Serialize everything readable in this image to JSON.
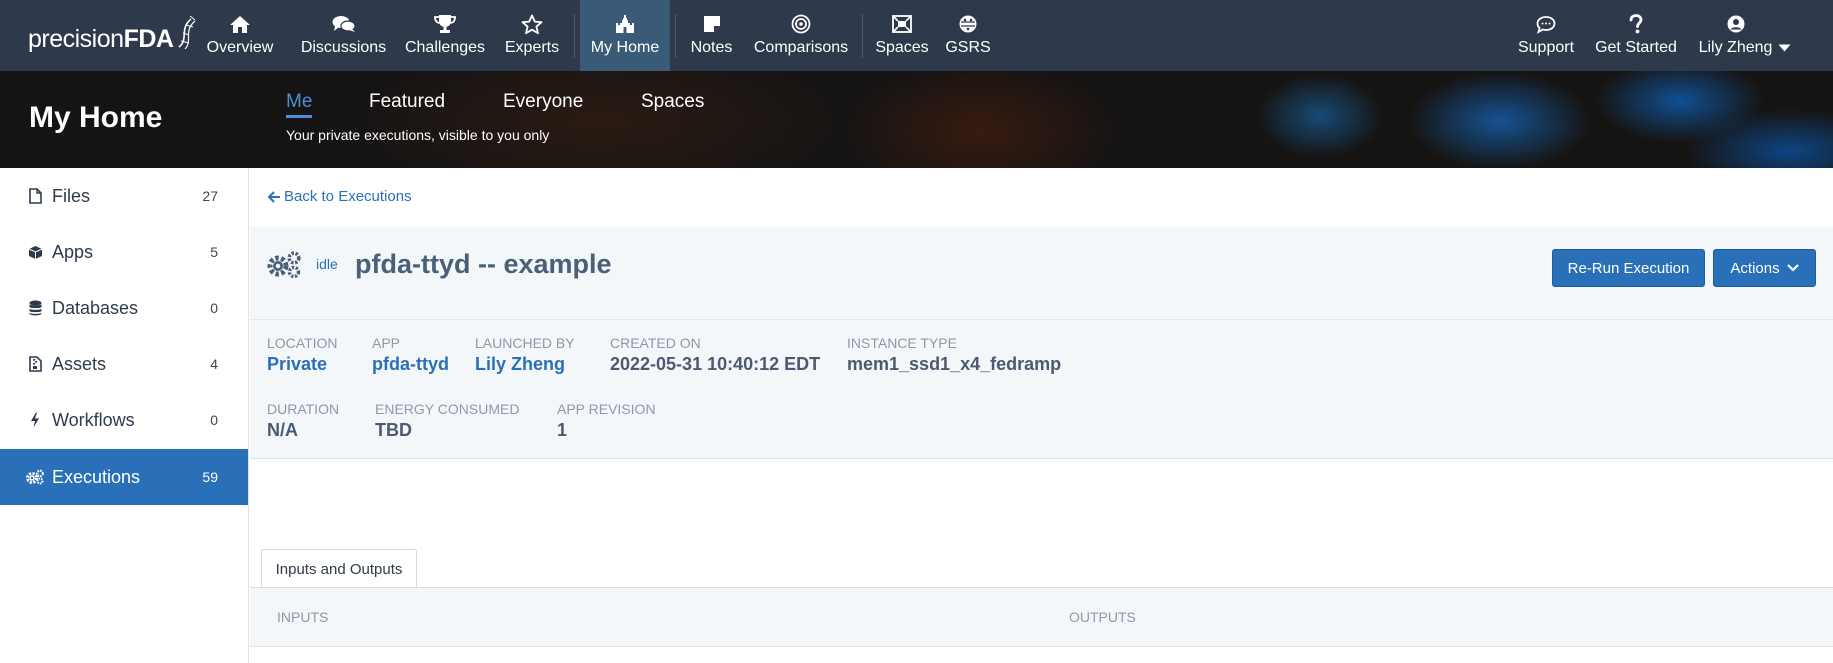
{
  "brand": {
    "name_thin": "precision",
    "name_bold": "FDA"
  },
  "nav": {
    "items": [
      {
        "label": "Overview",
        "icon": "home-icon"
      },
      {
        "label": "Discussions",
        "icon": "comments-icon"
      },
      {
        "label": "Challenges",
        "icon": "trophy-icon"
      },
      {
        "label": "Experts",
        "icon": "star-icon"
      },
      {
        "label": "My Home",
        "icon": "castle-icon",
        "active": true
      },
      {
        "label": "Notes",
        "icon": "note-icon"
      },
      {
        "label": "Comparisons",
        "icon": "bullseye-icon"
      },
      {
        "label": "Spaces",
        "icon": "spaces-icon"
      },
      {
        "label": "GSRS",
        "icon": "gsrs-icon"
      }
    ],
    "right": [
      {
        "label": "Support",
        "icon": "comment-icon"
      },
      {
        "label": "Get Started",
        "icon": "question-icon"
      },
      {
        "label": "Lily Zheng",
        "icon": "user-circle-icon"
      }
    ]
  },
  "hero": {
    "title": "My Home",
    "tabs": [
      "Me",
      "Featured",
      "Everyone",
      "Spaces"
    ],
    "active_tab": "Me",
    "subtitle": "Your private executions, visible to you only"
  },
  "sidebar": {
    "items": [
      {
        "label": "Files",
        "count": "27",
        "icon": "file-icon"
      },
      {
        "label": "Apps",
        "count": "5",
        "icon": "cube-icon"
      },
      {
        "label": "Databases",
        "count": "0",
        "icon": "database-icon"
      },
      {
        "label": "Assets",
        "count": "4",
        "icon": "file-archive-icon"
      },
      {
        "label": "Workflows",
        "count": "0",
        "icon": "bolt-icon"
      },
      {
        "label": "Executions",
        "count": "59",
        "icon": "cogs-icon",
        "active": true
      }
    ]
  },
  "main": {
    "back_label": "Back to Executions",
    "state": "idle",
    "title": "pfda-ttyd -- example",
    "rerun_label": "Re-Run Execution",
    "actions_label": "Actions",
    "fields": [
      {
        "label": "Location",
        "value": "Private"
      },
      {
        "label": "App",
        "value": "pfda-ttyd"
      },
      {
        "label": "Launched By",
        "value": "Lily Zheng"
      },
      {
        "label": "Created On",
        "value": "2022-05-31 10:40:12 EDT"
      },
      {
        "label": "Instance Type",
        "value": "mem1_ssd1_x4_fedramp"
      },
      {
        "label": "Duration",
        "value": "N/A"
      },
      {
        "label": "Energy Consumed",
        "value": "TBD"
      },
      {
        "label": "App Revision",
        "value": "1"
      }
    ],
    "io_tab_label": "Inputs and Outputs",
    "inputs_label": "INPUTS",
    "outputs_label": "OUTPUTS"
  },
  "colors": {
    "navbar": "#2e3a4b",
    "nav_active": "#3a5b78",
    "accent": "#2970b8",
    "panel": "#f4f7fa"
  }
}
